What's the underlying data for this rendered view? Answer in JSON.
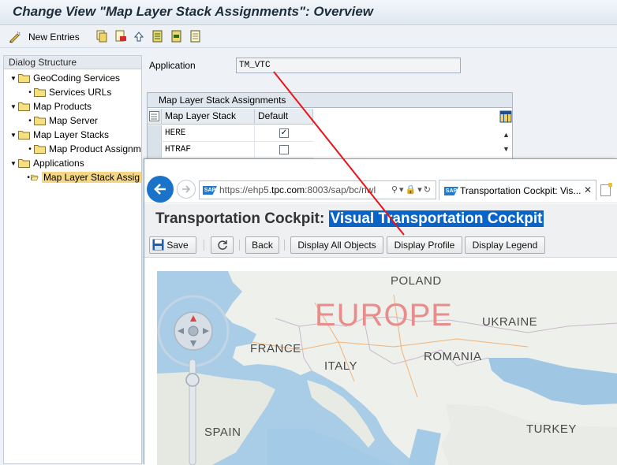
{
  "sap": {
    "title": "Change View \"Map Layer Stack Assignments\": Overview",
    "toolbar": {
      "new_entries": "New Entries"
    },
    "dialog_structure": {
      "header": "Dialog Structure",
      "items": [
        {
          "label": "GeoCoding Services"
        },
        {
          "label": "Services URLs"
        },
        {
          "label": "Map Products"
        },
        {
          "label": "Map Server"
        },
        {
          "label": "Map Layer Stacks"
        },
        {
          "label": "Map Product Assignm"
        },
        {
          "label": "Applications"
        },
        {
          "label": "Map Layer Stack Assig"
        }
      ]
    },
    "application": {
      "label": "Application",
      "value": "TM_VTC"
    },
    "table": {
      "title": "Map Layer Stack Assignments",
      "columns": [
        "Map Layer Stack",
        "Default"
      ],
      "rows": [
        {
          "stack": "HERE",
          "default": true
        },
        {
          "stack": "HTRAF",
          "default": false
        }
      ]
    }
  },
  "browser": {
    "url_prefix": "https://ehp5.",
    "url_domain": "tpc.com",
    "url_suffix": ":8003/sap/bc/nwl",
    "tab_title": "Transportation Cockpit: Vis...",
    "icon_text": "SAP"
  },
  "cockpit": {
    "title_prefix": "Transportation Cockpit: ",
    "title_highlight": "Visual Transportation Cockpit",
    "buttons": {
      "save": "Save",
      "back": "Back",
      "display_all": "Display All Objects",
      "display_profile": "Display Profile",
      "display_legend": "Display Legend"
    },
    "map": {
      "region": "EUROPE",
      "labels": [
        "POLAND",
        "UKRAINE",
        "FRANCE",
        "ROMANIA",
        "ITALY",
        "SPAIN",
        "TURKEY"
      ]
    }
  },
  "colors": {
    "annotation_line": "#e8141a",
    "highlight": "#0a64c8",
    "selection": "#f5d682"
  }
}
